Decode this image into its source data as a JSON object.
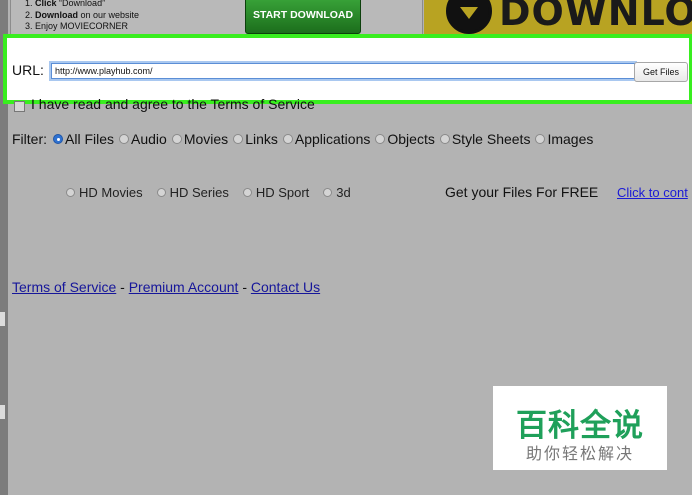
{
  "ad": {
    "steps": [
      {
        "num": "1.",
        "bold": "Click",
        "rest": " “Download”"
      },
      {
        "num": "2.",
        "bold": "Download",
        "rest": " on our website"
      },
      {
        "num": "3.",
        "bold": "",
        "rest": "Enjoy  MOVIECORNER"
      }
    ],
    "start_button": "START DOWNLOAD",
    "banner_text": "DOWNLOAD"
  },
  "url": {
    "label": "URL:",
    "value": "http://www.playhub.com/",
    "button": "Get Files"
  },
  "terms": {
    "text": "I have read and agree to the Terms of Service"
  },
  "filter": {
    "label": "Filter:",
    "options": [
      "All Files",
      "Audio",
      "Movies",
      "Links",
      "Applications",
      "Objects",
      "Style Sheets",
      "Images"
    ],
    "selected": "All Files"
  },
  "categories": [
    "HD Movies",
    "HD Series",
    "HD Sport",
    "3d"
  ],
  "promo": {
    "text": "Get your Files For FREE",
    "link": "Click to cont"
  },
  "footer": {
    "links": [
      "Terms of Service",
      "Premium Account",
      "Contact Us"
    ],
    "separator": "-"
  },
  "watermark": {
    "title": "百科全说",
    "subtitle": "助你轻松解决"
  },
  "colors": {
    "highlight_border": "#39ee1f",
    "selected_radio": "#2f72d1",
    "link": "#16169a",
    "watermark_green": "#1fa05a"
  }
}
